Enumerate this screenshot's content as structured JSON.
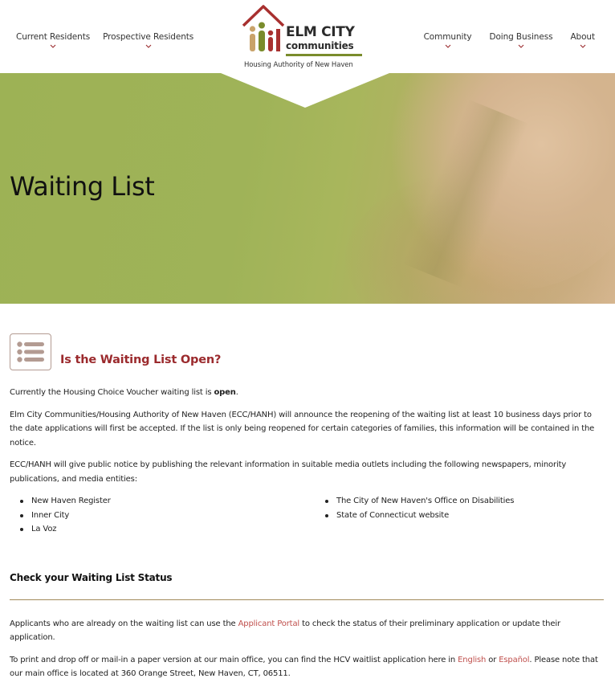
{
  "nav": {
    "left": [
      {
        "label": "Current Residents"
      },
      {
        "label": "Prospective Residents"
      }
    ],
    "right": [
      {
        "label": "Community"
      },
      {
        "label": "Doing Business"
      },
      {
        "label": "About"
      }
    ]
  },
  "logo": {
    "line1": "ELM CITY",
    "line2": "communities",
    "tagline": "Housing Authority of New Haven"
  },
  "hero": {
    "title": "Waiting List"
  },
  "section": {
    "title": "Is the Waiting List Open?",
    "p1_text": "Currently the Housing Choice Voucher waiting list is ",
    "p1_bold": "open",
    "p1_end": ".",
    "p2": "Elm City Communities/Housing Authority of New Haven (ECC/HANH) will announce the reopening of the waiting list at least 10 business days prior to the date applications will first be accepted. If the list is only being reopened for certain categories of families, this information will be contained in the notice.",
    "p3": "ECC/HANH will give public notice by publishing the relevant information in suitable media outlets including the following newspapers, minority publications, and media entities:",
    "list_left": [
      "New Haven Register",
      "Inner City",
      "La Voz"
    ],
    "list_right": [
      "The City of New Haven's Office on Disabilities",
      "State of Connecticut website"
    ]
  },
  "status": {
    "title": "Check your Waiting List Status",
    "p4_a": "Applicants who are already on the waiting list can use the ",
    "p4_link": "Applicant Portal",
    "p4_b": " to check the status of their preliminary application or update their application.",
    "p5_a": "To print and drop off or mail-in a paper version at our main office, you can find the HCV waitlist application here in ",
    "p5_link1": "English",
    "p5_or": " or ",
    "p5_link2": "Español",
    "p5_b": ". Please note that our main office is located at 360 Orange Street, New Haven, CT, 06511."
  },
  "colors": {
    "accent_red": "#9b2a2d",
    "link": "#c0504d",
    "hero_green": "#9db255",
    "divider": "#a28a5a"
  },
  "icons": [
    "chevron-down-icon",
    "list-icon",
    "house-logo-icon"
  ]
}
